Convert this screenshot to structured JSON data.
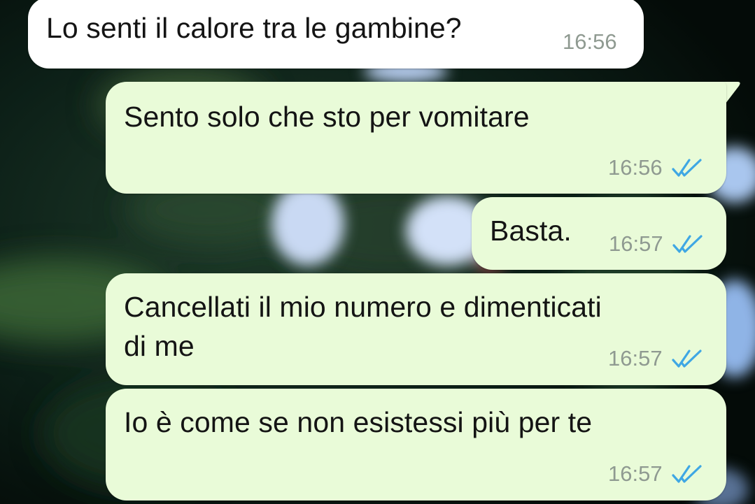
{
  "chat": {
    "accent_incoming": "#ffffff",
    "accent_outgoing": "#e9fbd8",
    "tick_color": "#3fa7e4",
    "messages": [
      {
        "direction": "incoming",
        "text": "Lo senti il calore tra le gambine?",
        "time": "16:56"
      },
      {
        "direction": "outgoing",
        "text": "Sento solo che sto per vomitare",
        "time": "16:56",
        "status_icon": "double-check-read-icon"
      },
      {
        "direction": "outgoing",
        "text": "Basta.",
        "time": "16:57",
        "status_icon": "double-check-read-icon"
      },
      {
        "direction": "outgoing",
        "text_line1": "Cancellati il mio numero e dimenticati",
        "text_line2": "di me",
        "time": "16:57",
        "status_icon": "double-check-read-icon"
      },
      {
        "direction": "outgoing",
        "text": "Io è come se non esistessi più per te",
        "time": "16:57",
        "status_icon": "double-check-read-icon"
      }
    ]
  }
}
